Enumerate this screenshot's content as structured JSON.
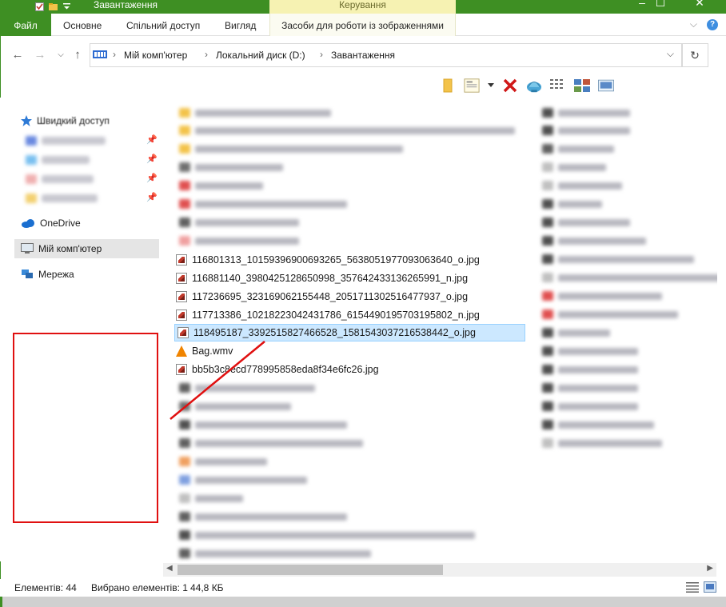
{
  "window": {
    "title": "Завантаження",
    "context_group": "Керування",
    "accent_color": "#3e8f23",
    "minimize_glyph": "–",
    "maximize_glyph": "☐",
    "close_glyph": "✕"
  },
  "ribbon": {
    "tabs": [
      {
        "label": "Файл"
      },
      {
        "label": "Основне"
      },
      {
        "label": "Спільний доступ"
      },
      {
        "label": "Вигляд"
      },
      {
        "label": "Засоби для роботи із зображеннями"
      }
    ],
    "collapse_glyph": "⌵",
    "help_glyph": "?"
  },
  "address": {
    "crumbs": [
      "Мій комп'ютер",
      "Локальний диск (D:)",
      "Завантаження"
    ],
    "separator": "›",
    "dropdown_glyph": "⌵",
    "refresh_glyph": "↻",
    "back_glyph": "←",
    "forward_glyph": "→",
    "recent_glyph": "⌵",
    "up_glyph": "↑"
  },
  "toolbar": {
    "icons": [
      "folder-icon",
      "properties-icon",
      "dropdown-arrow-icon",
      "delete-icon",
      "shell-icon",
      "details-view-icon",
      "tiles-view-icon",
      "preview-icon"
    ]
  },
  "nav": {
    "quick_access": "Швидкий доступ",
    "onedrive": "OneDrive",
    "this_pc": "Мій комп'ютер",
    "network": "Мережа",
    "pin_glyph": "📌"
  },
  "files": [
    {
      "name": "116801313_10159396900693265_5638051977093063640_o.jpg",
      "type": "jpg"
    },
    {
      "name": "116881140_3980425128650998_357642433136265991_n.jpg",
      "type": "jpg"
    },
    {
      "name": "117236695_323169062155448_2051711302516477937_o.jpg",
      "type": "jpg"
    },
    {
      "name": "117713386_10218223042431786_6154490195703195802_n.jpg",
      "type": "jpg"
    },
    {
      "name": "118495187_3392515827466528_1581543037216538442_o.jpg",
      "type": "jpg",
      "selected": true
    },
    {
      "name": "Bag.wmv",
      "type": "wmv"
    },
    {
      "name": "bb5b3c8ecd778995858eda8f34e6fc26.jpg",
      "type": "jpg"
    }
  ],
  "status": {
    "items_count": "Елементів: 44",
    "selected": "Вибрано елементів: 1",
    "size": "44,8 КБ"
  },
  "scroll": {
    "left_glyph": "◀",
    "right_glyph": "▶"
  }
}
